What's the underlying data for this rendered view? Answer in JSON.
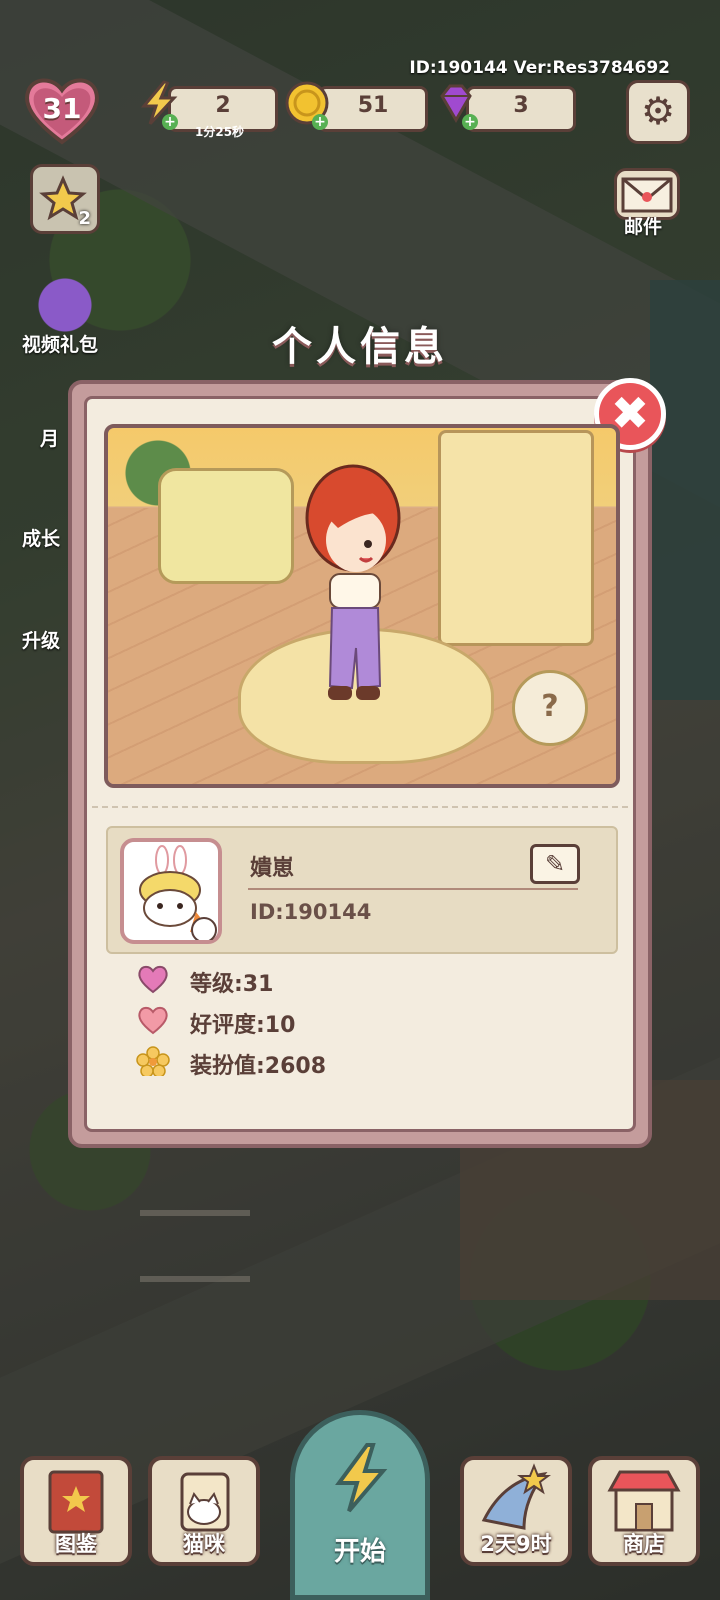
{
  "top_bar": {
    "id_version": "ID:190144  Ver:Res3784692",
    "level": "31",
    "energy": "2",
    "energy_timer": "1分25秒",
    "coins": "51",
    "gems": "3"
  },
  "side_buttons": {
    "mail": "邮件",
    "video_gift": "视频礼包",
    "monthly": "月",
    "growth": "成长",
    "upgrade": "升级",
    "star_badge": "2"
  },
  "dialog": {
    "title": "个人信息",
    "name": "嬇崽",
    "player_id": "ID:190144",
    "help_symbol": "?",
    "stats": {
      "level": "等级:31",
      "rating": "好评度:10",
      "outfit": "装扮值:2608"
    }
  },
  "bottom_nav": {
    "catalog": "图鉴",
    "cats": "猫咪",
    "start": "开始",
    "event": "2天9时",
    "shop": "商店"
  },
  "colors": {
    "panel_border": "#8a6266",
    "panel_bg": "#f3ecdf",
    "close_red": "#e9555a",
    "start_teal": "#6aa7a0"
  }
}
